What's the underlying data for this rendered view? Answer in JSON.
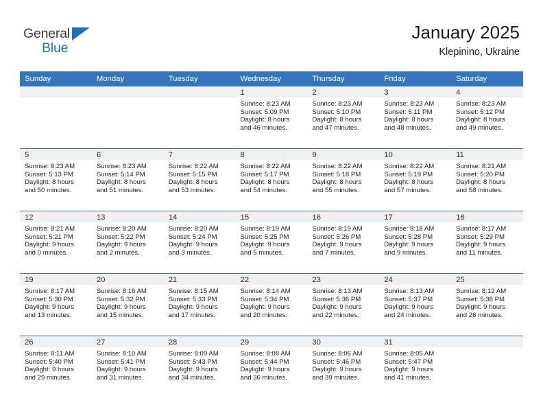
{
  "brand": {
    "name_top": "General",
    "name_bottom": "Blue",
    "triangle_color": "#1d70b8",
    "top_color": "#3c3c3c"
  },
  "header": {
    "title": "January 2025",
    "subtitle": "Klepinino, Ukraine"
  },
  "theme": {
    "header_bg": "#3376bb",
    "header_text": "#ffffff",
    "daynum_band_bg": "#f0f0f0",
    "cell_bg": "#ffffff",
    "row_divider": "#3376bb",
    "body_text": "#1c1c1c"
  },
  "weekday_headers": [
    "Sunday",
    "Monday",
    "Tuesday",
    "Wednesday",
    "Thursday",
    "Friday",
    "Saturday"
  ],
  "labels": {
    "sunrise_prefix": "Sunrise:",
    "sunset_prefix": "Sunset:",
    "daylight_prefix": "Daylight:"
  },
  "weeks": [
    [
      {
        "day": "",
        "empty": true,
        "l1": "",
        "l2": "",
        "l3": "",
        "l4": ""
      },
      {
        "day": "",
        "empty": true,
        "l1": "",
        "l2": "",
        "l3": "",
        "l4": ""
      },
      {
        "day": "",
        "empty": true,
        "l1": "",
        "l2": "",
        "l3": "",
        "l4": ""
      },
      {
        "day": "1",
        "empty": false,
        "l1": "Sunrise: 8:23 AM",
        "l2": "Sunset: 5:09 PM",
        "l3": "Daylight: 8 hours",
        "l4": "and 46 minutes."
      },
      {
        "day": "2",
        "empty": false,
        "l1": "Sunrise: 8:23 AM",
        "l2": "Sunset: 5:10 PM",
        "l3": "Daylight: 8 hours",
        "l4": "and 47 minutes."
      },
      {
        "day": "3",
        "empty": false,
        "l1": "Sunrise: 8:23 AM",
        "l2": "Sunset: 5:11 PM",
        "l3": "Daylight: 8 hours",
        "l4": "and 48 minutes."
      },
      {
        "day": "4",
        "empty": false,
        "l1": "Sunrise: 8:23 AM",
        "l2": "Sunset: 5:12 PM",
        "l3": "Daylight: 8 hours",
        "l4": "and 49 minutes."
      }
    ],
    [
      {
        "day": "5",
        "empty": false,
        "l1": "Sunrise: 8:23 AM",
        "l2": "Sunset: 5:13 PM",
        "l3": "Daylight: 8 hours",
        "l4": "and 50 minutes."
      },
      {
        "day": "6",
        "empty": false,
        "l1": "Sunrise: 8:23 AM",
        "l2": "Sunset: 5:14 PM",
        "l3": "Daylight: 8 hours",
        "l4": "and 51 minutes."
      },
      {
        "day": "7",
        "empty": false,
        "l1": "Sunrise: 8:22 AM",
        "l2": "Sunset: 5:15 PM",
        "l3": "Daylight: 8 hours",
        "l4": "and 53 minutes."
      },
      {
        "day": "8",
        "empty": false,
        "l1": "Sunrise: 8:22 AM",
        "l2": "Sunset: 5:17 PM",
        "l3": "Daylight: 8 hours",
        "l4": "and 54 minutes."
      },
      {
        "day": "9",
        "empty": false,
        "l1": "Sunrise: 8:22 AM",
        "l2": "Sunset: 5:18 PM",
        "l3": "Daylight: 8 hours",
        "l4": "and 55 minutes."
      },
      {
        "day": "10",
        "empty": false,
        "l1": "Sunrise: 8:22 AM",
        "l2": "Sunset: 5:19 PM",
        "l3": "Daylight: 8 hours",
        "l4": "and 57 minutes."
      },
      {
        "day": "11",
        "empty": false,
        "l1": "Sunrise: 8:21 AM",
        "l2": "Sunset: 5:20 PM",
        "l3": "Daylight: 8 hours",
        "l4": "and 58 minutes."
      }
    ],
    [
      {
        "day": "12",
        "empty": false,
        "l1": "Sunrise: 8:21 AM",
        "l2": "Sunset: 5:21 PM",
        "l3": "Daylight: 9 hours",
        "l4": "and 0 minutes."
      },
      {
        "day": "13",
        "empty": false,
        "l1": "Sunrise: 8:20 AM",
        "l2": "Sunset: 5:22 PM",
        "l3": "Daylight: 9 hours",
        "l4": "and 2 minutes."
      },
      {
        "day": "14",
        "empty": false,
        "l1": "Sunrise: 8:20 AM",
        "l2": "Sunset: 5:24 PM",
        "l3": "Daylight: 9 hours",
        "l4": "and 3 minutes."
      },
      {
        "day": "15",
        "empty": false,
        "l1": "Sunrise: 8:19 AM",
        "l2": "Sunset: 5:25 PM",
        "l3": "Daylight: 9 hours",
        "l4": "and 5 minutes."
      },
      {
        "day": "16",
        "empty": false,
        "l1": "Sunrise: 8:19 AM",
        "l2": "Sunset: 5:26 PM",
        "l3": "Daylight: 9 hours",
        "l4": "and 7 minutes."
      },
      {
        "day": "17",
        "empty": false,
        "l1": "Sunrise: 8:18 AM",
        "l2": "Sunset: 5:28 PM",
        "l3": "Daylight: 9 hours",
        "l4": "and 9 minutes."
      },
      {
        "day": "18",
        "empty": false,
        "l1": "Sunrise: 8:17 AM",
        "l2": "Sunset: 5:29 PM",
        "l3": "Daylight: 9 hours",
        "l4": "and 11 minutes."
      }
    ],
    [
      {
        "day": "19",
        "empty": false,
        "l1": "Sunrise: 8:17 AM",
        "l2": "Sunset: 5:30 PM",
        "l3": "Daylight: 9 hours",
        "l4": "and 13 minutes."
      },
      {
        "day": "20",
        "empty": false,
        "l1": "Sunrise: 8:16 AM",
        "l2": "Sunset: 5:32 PM",
        "l3": "Daylight: 9 hours",
        "l4": "and 15 minutes."
      },
      {
        "day": "21",
        "empty": false,
        "l1": "Sunrise: 8:15 AM",
        "l2": "Sunset: 5:33 PM",
        "l3": "Daylight: 9 hours",
        "l4": "and 17 minutes."
      },
      {
        "day": "22",
        "empty": false,
        "l1": "Sunrise: 8:14 AM",
        "l2": "Sunset: 5:34 PM",
        "l3": "Daylight: 9 hours",
        "l4": "and 20 minutes."
      },
      {
        "day": "23",
        "empty": false,
        "l1": "Sunrise: 8:13 AM",
        "l2": "Sunset: 5:36 PM",
        "l3": "Daylight: 9 hours",
        "l4": "and 22 minutes."
      },
      {
        "day": "24",
        "empty": false,
        "l1": "Sunrise: 8:13 AM",
        "l2": "Sunset: 5:37 PM",
        "l3": "Daylight: 9 hours",
        "l4": "and 24 minutes."
      },
      {
        "day": "25",
        "empty": false,
        "l1": "Sunrise: 8:12 AM",
        "l2": "Sunset: 5:38 PM",
        "l3": "Daylight: 9 hours",
        "l4": "and 26 minutes."
      }
    ],
    [
      {
        "day": "26",
        "empty": false,
        "l1": "Sunrise: 8:11 AM",
        "l2": "Sunset: 5:40 PM",
        "l3": "Daylight: 9 hours",
        "l4": "and 29 minutes."
      },
      {
        "day": "27",
        "empty": false,
        "l1": "Sunrise: 8:10 AM",
        "l2": "Sunset: 5:41 PM",
        "l3": "Daylight: 9 hours",
        "l4": "and 31 minutes."
      },
      {
        "day": "28",
        "empty": false,
        "l1": "Sunrise: 8:09 AM",
        "l2": "Sunset: 5:43 PM",
        "l3": "Daylight: 9 hours",
        "l4": "and 34 minutes."
      },
      {
        "day": "29",
        "empty": false,
        "l1": "Sunrise: 8:08 AM",
        "l2": "Sunset: 5:44 PM",
        "l3": "Daylight: 9 hours",
        "l4": "and 36 minutes."
      },
      {
        "day": "30",
        "empty": false,
        "l1": "Sunrise: 8:06 AM",
        "l2": "Sunset: 5:46 PM",
        "l3": "Daylight: 9 hours",
        "l4": "and 39 minutes."
      },
      {
        "day": "31",
        "empty": false,
        "l1": "Sunrise: 8:05 AM",
        "l2": "Sunset: 5:47 PM",
        "l3": "Daylight: 9 hours",
        "l4": "and 41 minutes."
      },
      {
        "day": "",
        "empty": true,
        "l1": "",
        "l2": "",
        "l3": "",
        "l4": ""
      }
    ]
  ]
}
